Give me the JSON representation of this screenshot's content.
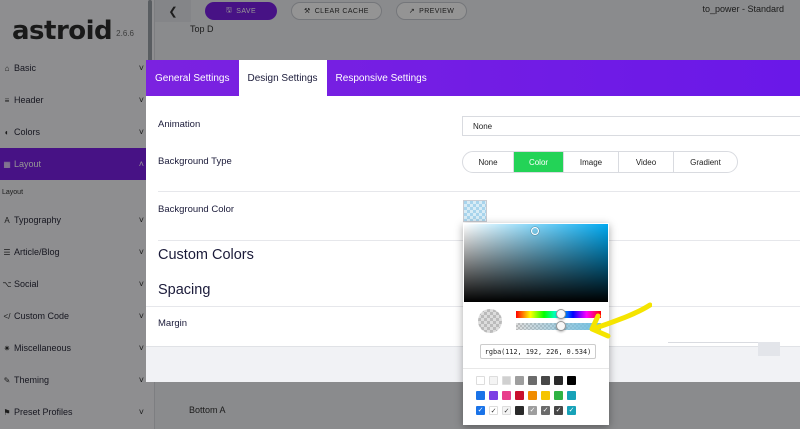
{
  "app": {
    "logo": "astroid",
    "version": "2.6.6"
  },
  "topbar": {
    "back_icon": "chevron-left-icon",
    "save_label": "SAVE",
    "clear_cache_label": "CLEAR CACHE",
    "preview_label": "PREVIEW",
    "template_title": "to_power - Standard"
  },
  "sidebar": {
    "items": [
      {
        "label": "Basic",
        "icon": "home-icon"
      },
      {
        "label": "Header",
        "icon": "header-icon"
      },
      {
        "label": "Colors",
        "icon": "palette-icon"
      },
      {
        "label": "Layout",
        "icon": "layout-icon",
        "active": true
      },
      {
        "label": "Typography",
        "icon": "font-icon"
      },
      {
        "label": "Article/Blog",
        "icon": "article-icon"
      },
      {
        "label": "Social",
        "icon": "share-icon"
      },
      {
        "label": "Custom Code",
        "icon": "code-icon"
      },
      {
        "label": "Miscellaneous",
        "icon": "misc-icon"
      },
      {
        "label": "Theming",
        "icon": "brush-icon"
      },
      {
        "label": "Preset Profiles",
        "icon": "flag-icon"
      }
    ],
    "sub_item": "Layout"
  },
  "background": {
    "label_top": "Top D",
    "label_bottom": "Bottom A"
  },
  "modal": {
    "tabs": [
      {
        "label": "General Settings",
        "active": false
      },
      {
        "label": "Design Settings",
        "active": true
      },
      {
        "label": "Responsive Settings",
        "active": false
      }
    ],
    "animation_label": "Animation",
    "animation_value": "None",
    "bg_type_label": "Background Type",
    "bg_type_options": [
      "None",
      "Color",
      "Image",
      "Video",
      "Gradient"
    ],
    "bg_type_selected": "Color",
    "bg_color_label": "Background Color",
    "custom_colors_heading": "Custom Colors",
    "spacing_heading": "Spacing",
    "margin_label": "Margin"
  },
  "color_picker": {
    "value": "rgba(112, 192, 226, 0.534)",
    "hue_fraction": 0.53,
    "alpha": 0.534,
    "swatches": [
      {
        "color": "#ffffff",
        "checked": false
      },
      {
        "color": "#f4f4f4",
        "checked": false
      },
      {
        "color": "#d0d0d0",
        "checked": false
      },
      {
        "color": "#9e9e9e",
        "checked": false
      },
      {
        "color": "#6b6b6b",
        "checked": false
      },
      {
        "color": "#474747",
        "checked": false
      },
      {
        "color": "#2a2a2a",
        "checked": false
      },
      {
        "color": "#000000",
        "checked": false
      },
      {
        "color": "#1a73e8",
        "checked": false
      },
      {
        "color": "#7b3fe4",
        "checked": false
      },
      {
        "color": "#e83e8c",
        "checked": false
      },
      {
        "color": "#c8102e",
        "checked": false
      },
      {
        "color": "#f08c00",
        "checked": false
      },
      {
        "color": "#f5c400",
        "checked": false
      },
      {
        "color": "#2fb344",
        "checked": false
      },
      {
        "color": "#17a2b8",
        "checked": false
      },
      {
        "color": "#1a73e8",
        "checked": true
      },
      {
        "color": "#ffffff",
        "checked": true
      },
      {
        "color": "#f4f4f4",
        "checked": true
      },
      {
        "color": "#2a2a2a",
        "checked": false
      },
      {
        "color": "#9e9e9e",
        "checked": true
      },
      {
        "color": "#6b6b6b",
        "checked": true
      },
      {
        "color": "#474747",
        "checked": true
      },
      {
        "color": "#17a2b8",
        "checked": true
      }
    ]
  },
  "annotation": {
    "icon": "yellow-arrow-icon",
    "color": "#f5e400"
  }
}
